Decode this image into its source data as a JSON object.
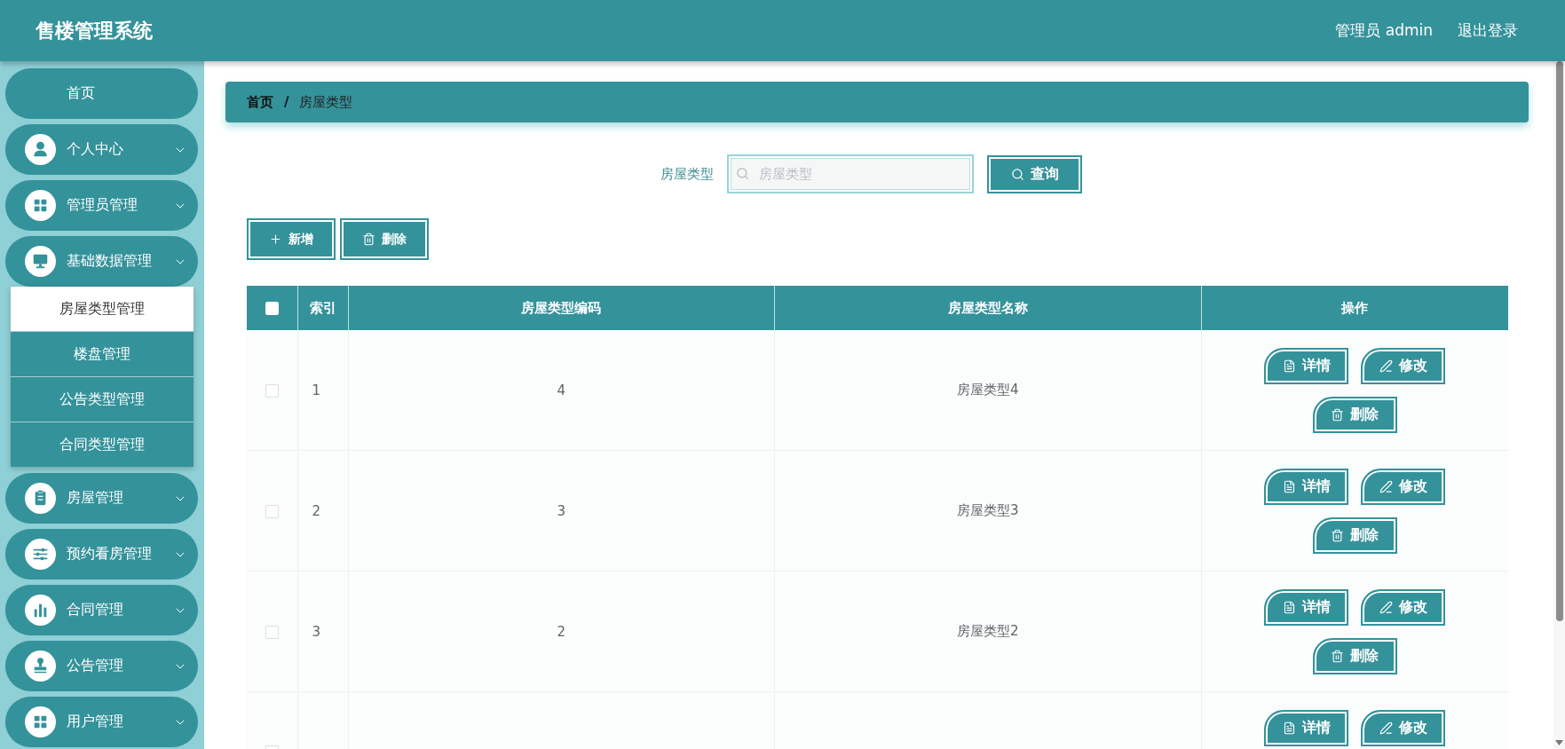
{
  "header": {
    "title": "售楼管理系统",
    "user": "管理员 admin",
    "logout": "退出登录"
  },
  "sidebar": {
    "items": [
      {
        "kind": "link",
        "label": "首页",
        "selected": false
      },
      {
        "kind": "menu",
        "label": "个人中心",
        "selected": false
      },
      {
        "kind": "menu",
        "label": "管理员管理",
        "selected": false
      },
      {
        "kind": "menu",
        "label": "基础数据管理",
        "selected": false,
        "children": [
          {
            "label": "房屋类型管理",
            "selected": true
          },
          {
            "label": "楼盘管理",
            "selected": false
          },
          {
            "label": "公告类型管理",
            "selected": false
          },
          {
            "label": "合同类型管理",
            "selected": false
          }
        ]
      },
      {
        "kind": "menu",
        "label": "房屋管理",
        "selected": false
      },
      {
        "kind": "menu",
        "label": "预约看房管理",
        "selected": false
      },
      {
        "kind": "menu",
        "label": "合同管理",
        "selected": false
      },
      {
        "kind": "menu",
        "label": "公告管理",
        "selected": false
      },
      {
        "kind": "menu",
        "label": "用户管理",
        "selected": false
      }
    ]
  },
  "breadcrumb": {
    "items": [
      "首页",
      "房屋类型"
    ],
    "separator": "/"
  },
  "search": {
    "label": "房屋类型",
    "placeholder": "房屋类型",
    "button": "查询"
  },
  "toolbar": [
    {
      "kind": "add",
      "label": "新增"
    },
    {
      "kind": "delete",
      "label": "删除"
    }
  ],
  "table": {
    "select_all": {
      "checked": false
    },
    "columns": [
      "索引",
      "房屋类型编码",
      "房屋类型名称",
      "操作"
    ],
    "rows": [
      {
        "checked": false,
        "index": "1",
        "code": "4",
        "name": "房屋类型4",
        "actions": [
          {
            "kind": "detail",
            "label": "详情"
          },
          {
            "kind": "edit",
            "label": "修改"
          },
          {
            "kind": "delete",
            "label": "删除"
          }
        ]
      },
      {
        "checked": false,
        "index": "2",
        "code": "3",
        "name": "房屋类型3",
        "actions": [
          {
            "kind": "detail",
            "label": "详情"
          },
          {
            "kind": "edit",
            "label": "修改"
          },
          {
            "kind": "delete",
            "label": "删除"
          }
        ]
      },
      {
        "checked": false,
        "index": "3",
        "code": "2",
        "name": "房屋类型2",
        "actions": [
          {
            "kind": "detail",
            "label": "详情"
          },
          {
            "kind": "edit",
            "label": "修改"
          },
          {
            "kind": "delete",
            "label": "删除"
          }
        ]
      },
      {
        "checked": false,
        "actions": [
          {
            "kind": "detail",
            "label": "详情"
          },
          {
            "kind": "edit",
            "label": "修改"
          }
        ]
      }
    ]
  }
}
